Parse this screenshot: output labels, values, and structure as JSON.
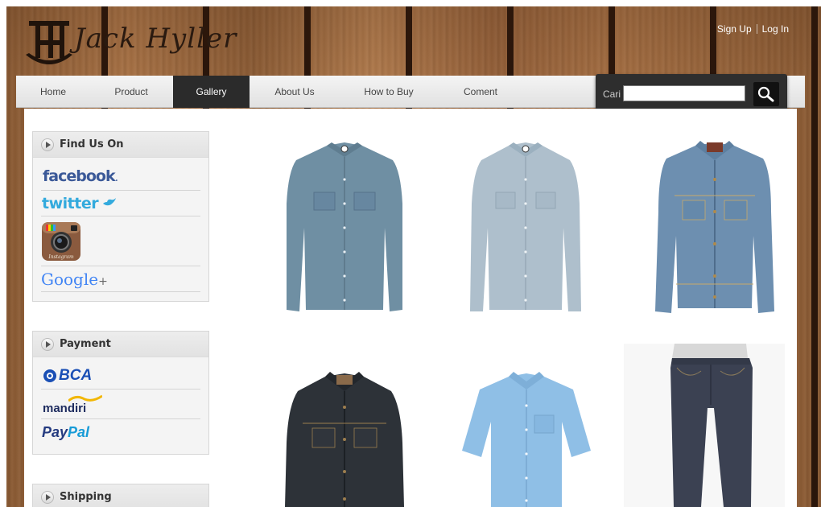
{
  "brand": {
    "logo_text": "Jack Hyller",
    "logo_mark": "JH"
  },
  "toplinks": {
    "signup": "Sign Up",
    "login": "Log In"
  },
  "nav": {
    "items": [
      {
        "label": "Home"
      },
      {
        "label": "Product"
      },
      {
        "label": "Gallery",
        "active": true
      },
      {
        "label": "About Us"
      },
      {
        "label": "How to Buy"
      },
      {
        "label": "Coment"
      }
    ]
  },
  "search": {
    "label": "Cari",
    "value": "",
    "icon": "search-icon"
  },
  "sidebar": {
    "find_us": {
      "title": "Find Us On",
      "items": [
        {
          "name": "facebook",
          "text": "facebook",
          "suffix": "."
        },
        {
          "name": "twitter",
          "text": "twitter"
        },
        {
          "name": "instagram",
          "text": "Instagram"
        },
        {
          "name": "google-plus",
          "text": "Google",
          "suffix": "+"
        }
      ]
    },
    "payment": {
      "title": "Payment",
      "items": [
        {
          "name": "bca",
          "text": "BCA"
        },
        {
          "name": "mandiri",
          "text": "mandiri"
        },
        {
          "name": "paypal",
          "text": "PayPal",
          "part1": "Pay",
          "part2": "Pal"
        }
      ]
    },
    "shipping": {
      "title": "Shipping"
    }
  },
  "gallery": {
    "products": [
      {
        "name": "chambray-shirt",
        "color": "#6f8fa3"
      },
      {
        "name": "light-blue-shirt",
        "color": "#aebfcc"
      },
      {
        "name": "denim-jacket",
        "color": "#6d8fb0"
      },
      {
        "name": "dark-denim-jacket",
        "color": "#2d3238"
      },
      {
        "name": "oxford-shirt",
        "color": "#8fbfe6"
      },
      {
        "name": "dark-jeans",
        "color": "#3b4152"
      }
    ]
  },
  "colors": {
    "nav_active": "#2b2b2b",
    "search_bg": "#2e2e2e"
  }
}
